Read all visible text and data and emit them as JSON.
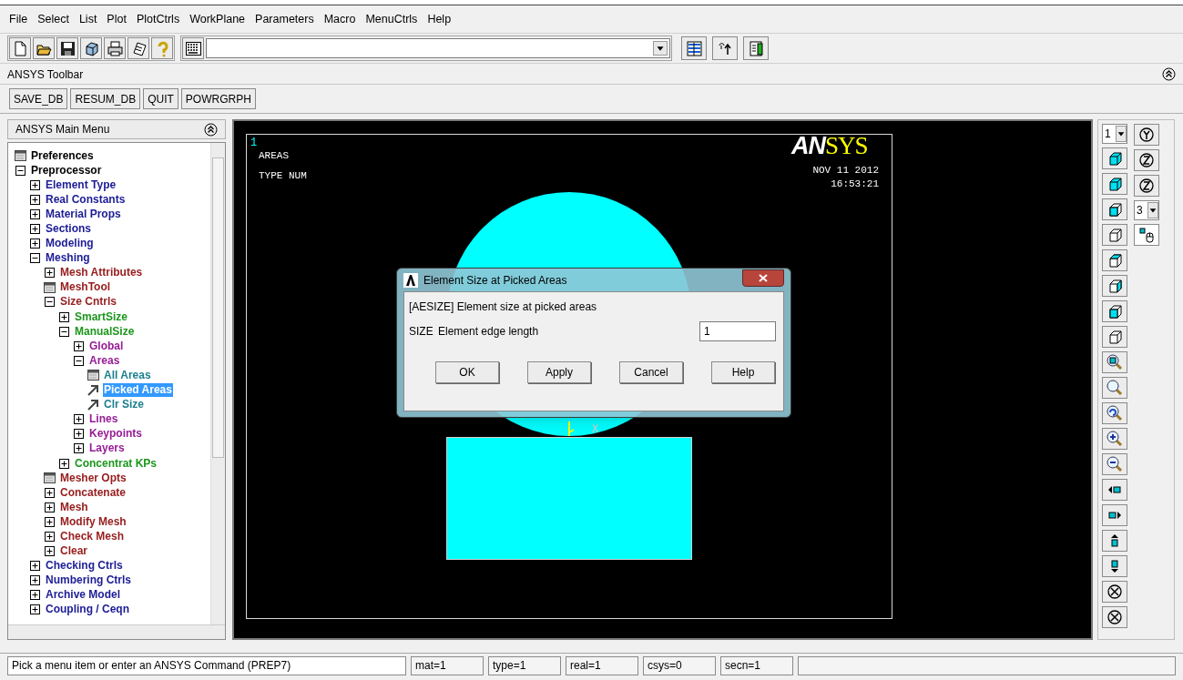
{
  "menu_bar": [
    "File",
    "Select",
    "List",
    "Plot",
    "PlotCtrls",
    "WorkPlane",
    "Parameters",
    "Macro",
    "MenuCtrls",
    "Help"
  ],
  "ansys_toolbar": {
    "title": "ANSYS Toolbar",
    "buttons": [
      "SAVE_DB",
      "RESUM_DB",
      "QUIT",
      "POWRGRPH"
    ]
  },
  "main_menu": {
    "title": "ANSYS Main Menu",
    "tree": [
      {
        "label": "Preferences",
        "kind": "dialog",
        "color": "#000000",
        "selected": false
      },
      {
        "label": "Preprocessor",
        "kind": "folder",
        "expanded": true,
        "color": "#000000",
        "selected": false,
        "children": [
          {
            "label": "Element Type",
            "kind": "folder",
            "expanded": false,
            "color": "#1c1c96",
            "selected": false
          },
          {
            "label": "Real Constants",
            "kind": "folder",
            "expanded": false,
            "color": "#1c1c96",
            "selected": false
          },
          {
            "label": "Material Props",
            "kind": "folder",
            "expanded": false,
            "color": "#1c1c96",
            "selected": false
          },
          {
            "label": "Sections",
            "kind": "folder",
            "expanded": false,
            "color": "#1c1c96",
            "selected": false
          },
          {
            "label": "Modeling",
            "kind": "folder",
            "expanded": false,
            "color": "#1c1c96",
            "selected": false
          },
          {
            "label": "Meshing",
            "kind": "folder",
            "expanded": true,
            "color": "#1c1c96",
            "selected": false,
            "children": [
              {
                "label": "Mesh Attributes",
                "kind": "folder",
                "expanded": false,
                "color": "#961c1c",
                "selected": false
              },
              {
                "label": "MeshTool",
                "kind": "dialog",
                "color": "#961c1c",
                "selected": false
              },
              {
                "label": "Size Cntrls",
                "kind": "folder",
                "expanded": true,
                "color": "#961c1c",
                "selected": false,
                "children": [
                  {
                    "label": "SmartSize",
                    "kind": "folder",
                    "expanded": false,
                    "color": "#1c961c",
                    "selected": false
                  },
                  {
                    "label": "ManualSize",
                    "kind": "folder",
                    "expanded": true,
                    "color": "#1c961c",
                    "selected": false,
                    "children": [
                      {
                        "label": "Global",
                        "kind": "folder",
                        "expanded": false,
                        "color": "#961c96",
                        "selected": false
                      },
                      {
                        "label": "Areas",
                        "kind": "folder",
                        "expanded": true,
                        "color": "#961c96",
                        "selected": false,
                        "children": [
                          {
                            "label": "All Areas",
                            "kind": "dialog",
                            "color": "#1c7f8f",
                            "selected": false
                          },
                          {
                            "label": "Picked Areas",
                            "kind": "pick",
                            "selected": true
                          },
                          {
                            "label": "Clr Size",
                            "kind": "pick",
                            "color": "#1c7f8f",
                            "selected": false
                          }
                        ]
                      },
                      {
                        "label": "Lines",
                        "kind": "folder",
                        "expanded": false,
                        "color": "#961c96",
                        "selected": false
                      },
                      {
                        "label": "Keypoints",
                        "kind": "folder",
                        "expanded": false,
                        "color": "#961c96",
                        "selected": false
                      },
                      {
                        "label": "Layers",
                        "kind": "folder",
                        "expanded": false,
                        "color": "#961c96",
                        "selected": false
                      }
                    ]
                  },
                  {
                    "label": "Concentrat KPs",
                    "kind": "folder",
                    "expanded": false,
                    "color": "#1c961c",
                    "selected": false
                  }
                ]
              },
              {
                "label": "Mesher Opts",
                "kind": "dialog",
                "color": "#961c1c",
                "selected": false
              },
              {
                "label": "Concatenate",
                "kind": "folder",
                "expanded": false,
                "color": "#961c1c",
                "selected": false
              },
              {
                "label": "Mesh",
                "kind": "folder",
                "expanded": false,
                "color": "#961c1c",
                "selected": false
              },
              {
                "label": "Modify Mesh",
                "kind": "folder",
                "expanded": false,
                "color": "#961c1c",
                "selected": false
              },
              {
                "label": "Check Mesh",
                "kind": "folder",
                "expanded": false,
                "color": "#961c1c",
                "selected": false
              },
              {
                "label": "Clear",
                "kind": "folder",
                "expanded": false,
                "color": "#961c1c",
                "selected": false
              }
            ]
          },
          {
            "label": "Checking Ctrls",
            "kind": "folder",
            "expanded": false,
            "color": "#1c1c96",
            "selected": false
          },
          {
            "label": "Numbering Ctrls",
            "kind": "folder",
            "expanded": false,
            "color": "#1c1c96",
            "selected": false
          },
          {
            "label": "Archive Model",
            "kind": "folder",
            "expanded": false,
            "color": "#1c1c96",
            "selected": false
          },
          {
            "label": "Coupling / Ceqn",
            "kind": "folder",
            "expanded": false,
            "color": "#1c1c96",
            "selected": false
          }
        ]
      }
    ]
  },
  "graphics": {
    "window_number": "1",
    "labels": [
      "AREAS",
      "TYPE NUM"
    ],
    "logo": {
      "part_1": "AN",
      "part_2": "SYS"
    },
    "date": "NOV 11 2012",
    "time": "16:53:21",
    "axis_label": "X"
  },
  "dialog": {
    "title": "Element Size at Picked Areas",
    "description": "[AESIZE]  Element size at picked areas",
    "field": {
      "name": "SIZE",
      "label": "Element edge length",
      "value": "1"
    },
    "buttons": [
      "OK",
      "Apply",
      "Cancel",
      "Help"
    ]
  },
  "right_toolbar": {
    "window_select": "1",
    "step_select": "3"
  },
  "status_bar": {
    "prompt": "Pick a menu item or enter an ANSYS Command (PREP7)",
    "fields": [
      "mat=1",
      "type=1",
      "real=1",
      "csys=0",
      "secn=1"
    ]
  }
}
